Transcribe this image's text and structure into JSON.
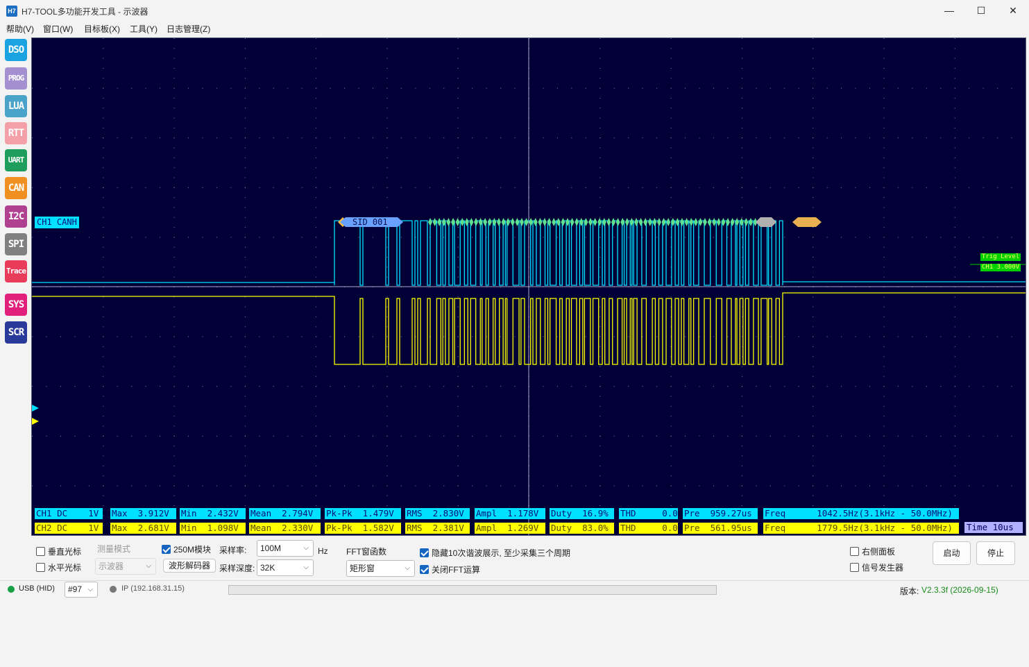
{
  "window": {
    "title": "H7-TOOL多功能开发工具 - 示波器",
    "icon_text": "H7",
    "minimize": "—",
    "maximize": "☐",
    "close": "✕"
  },
  "menu": [
    "帮助(V)",
    "窗口(W)",
    "目标板(X)",
    "工具(Y)",
    "日志管理(Z)"
  ],
  "sidebar": [
    {
      "label": "DSO",
      "color": "#1aa3e0"
    },
    {
      "label": "PROG",
      "color": "#a48fd0"
    },
    {
      "label": "LUA",
      "color": "#4aa3c8"
    },
    {
      "label": "RTT",
      "color": "#f4a0a8"
    },
    {
      "label": "UART",
      "color": "#1e9e5a"
    },
    {
      "label": "CAN",
      "color": "#f09020"
    },
    {
      "label": "I2C",
      "color": "#b04090"
    },
    {
      "label": "SPI",
      "color": "#808080"
    },
    {
      "label": "Trace",
      "color": "#e83c5a"
    },
    {
      "label": "SYS",
      "color": "#e0207a"
    },
    {
      "label": "SCR",
      "color": "#2a3a9a"
    }
  ],
  "scope": {
    "ch1_label": "CH1 CANH",
    "decode_sid": "SID 001",
    "trig_level_label": "Trig Level",
    "trig_level_value": "CH1 3.000V",
    "time": "Time 10us",
    "colors": {
      "background": "#000036",
      "ch1": "#00e0ff",
      "ch2": "#ffff00",
      "grid": "#8888aa"
    }
  },
  "measurements": {
    "ch1": [
      "CH1 DC    1V",
      "Max  3.912V",
      "Min  2.432V",
      "Mean  2.794V",
      "Pk-Pk  1.479V",
      "RMS  2.830V",
      "Ampl  1.178V",
      "Duty  16.9%",
      "THD     0.0",
      "Pre  959.27us",
      "Freq      1042.5Hz(3.1kHz - 50.0MHz)"
    ],
    "ch2": [
      "CH2 DC    1V",
      "Max  2.681V",
      "Min  1.098V",
      "Mean  2.330V",
      "Pk-Pk  1.582V",
      "RMS  2.381V",
      "Ampl  1.269V",
      "Duty  83.0%",
      "THD     0.0",
      "Pre  561.95us",
      "Freq      1779.5Hz(3.1kHz - 50.0MHz)"
    ]
  },
  "controls": {
    "vertical_cursor": "垂直光标",
    "horizontal_cursor": "水平光标",
    "measure_mode_label": "测量模式",
    "measure_mode_value": "示波器",
    "module_250m": "250M模块",
    "wave_decoder": "波形解码器",
    "sample_rate_label": "采样率:",
    "sample_rate_value": "100M",
    "sample_rate_unit": "Hz",
    "sample_depth_label": "采样深度:",
    "sample_depth_value": "32K",
    "fft_window_label": "FFT窗函数",
    "fft_window_value": "矩形窗",
    "hide_harmonics": "隐藏10次谐波展示, 至少采集三个周期",
    "close_fft": "关闭FFT运算",
    "right_panel": "右侧面板",
    "signal_generator": "信号发生器",
    "start": "启动",
    "stop": "停止"
  },
  "status": {
    "usb": "USB (HID)",
    "port": "#97",
    "ip": "IP (192.168.31.15)",
    "version_label": "版本:",
    "version_value": "V2.3.3f (2026-09-15)"
  }
}
